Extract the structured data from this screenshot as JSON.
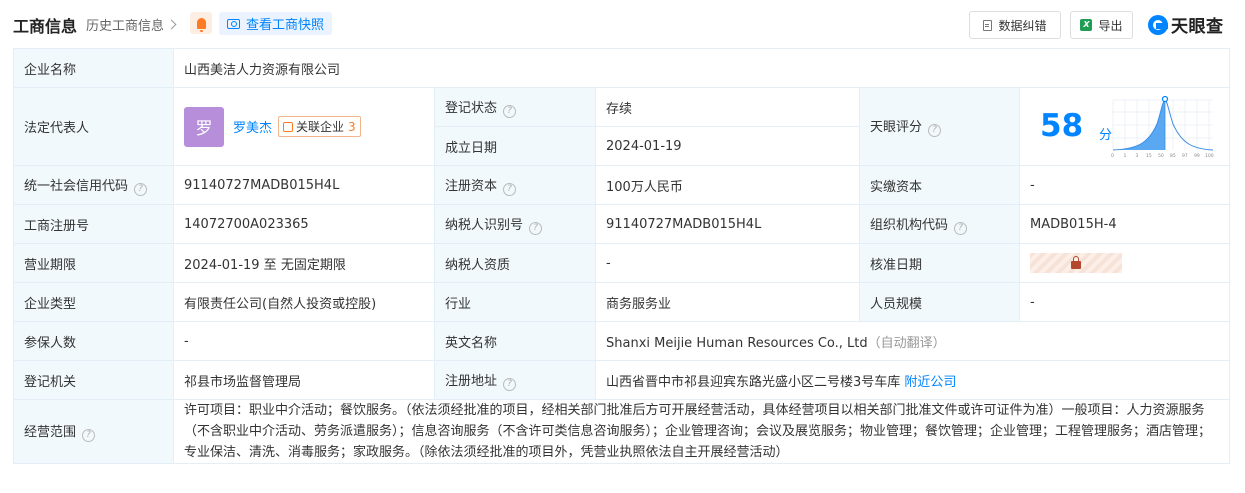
{
  "header": {
    "title": "工商信息",
    "history_link": "历史工商信息",
    "snapshot_button": "查看工商快照",
    "correct_button": "数据纠错",
    "export_button": "导出",
    "logo_text": "天眼查",
    "accent_color": "#0084ff"
  },
  "company": {
    "name_label": "企业名称",
    "name_value": "山西美洁人力资源有限公司",
    "legal_rep_label": "法定代表人",
    "legal_rep_avatar": "罗",
    "legal_rep_name": "罗美杰",
    "related_label": "关联企业",
    "related_count": "3",
    "reg_status_label": "登记状态",
    "reg_status_value": "存续",
    "founded_label": "成立日期",
    "founded_value": "2024-01-19",
    "score_label": "天眼评分",
    "score_value": "58",
    "score_unit": "分",
    "score_axis": [
      "0",
      "1",
      "3",
      "15",
      "50",
      "85",
      "97",
      "99",
      "100"
    ],
    "credit_code_label": "统一社会信用代码",
    "credit_code_value": "91140727MADB015H4L",
    "reg_capital_label": "注册资本",
    "reg_capital_value": "100万人民币",
    "paid_capital_label": "实缴资本",
    "paid_capital_value": "-",
    "reg_no_label": "工商注册号",
    "reg_no_value": "14072700A023365",
    "tax_id_label": "纳税人识别号",
    "tax_id_value": "91140727MADB015H4L",
    "org_code_label": "组织机构代码",
    "org_code_value": "MADB015H-4",
    "term_label": "营业期限",
    "term_value": "2024-01-19 至 无固定期限",
    "taxpayer_label": "纳税人资质",
    "taxpayer_value": "-",
    "approve_label": "核准日期",
    "type_label": "企业类型",
    "type_value": "有限责任公司(自然人投资或控股)",
    "industry_label": "行业",
    "industry_value": "商务服务业",
    "staff_label": "人员规模",
    "staff_value": "-",
    "insured_label": "参保人数",
    "insured_value": "-",
    "english_label": "英文名称",
    "english_value": "Shanxi Meijie Human Resources Co., Ltd",
    "english_note": "（自动翻译）",
    "authority_label": "登记机关",
    "authority_value": "祁县市场监督管理局",
    "address_label": "注册地址",
    "address_value": "山西省晋中市祁县迎宾东路光盛小区二号楼3号车库",
    "nearby_link": "附近公司",
    "scope_label": "经营范围",
    "scope_value": "许可项目：职业中介活动；餐饮服务。（依法须经批准的项目，经相关部门批准后方可开展经营活动，具体经营项目以相关部门批准文件或许可证件为准）一般项目：人力资源服务（不含职业中介活动、劳务派遣服务）；信息咨询服务（不含许可类信息咨询服务）；企业管理咨询；会议及展览服务；物业管理；餐饮管理；企业管理；工程管理服务；酒店管理；专业保洁、清洗、消毒服务；家政服务。（除依法须经批准的项目外，凭营业执照依法自主开展经营活动）"
  }
}
